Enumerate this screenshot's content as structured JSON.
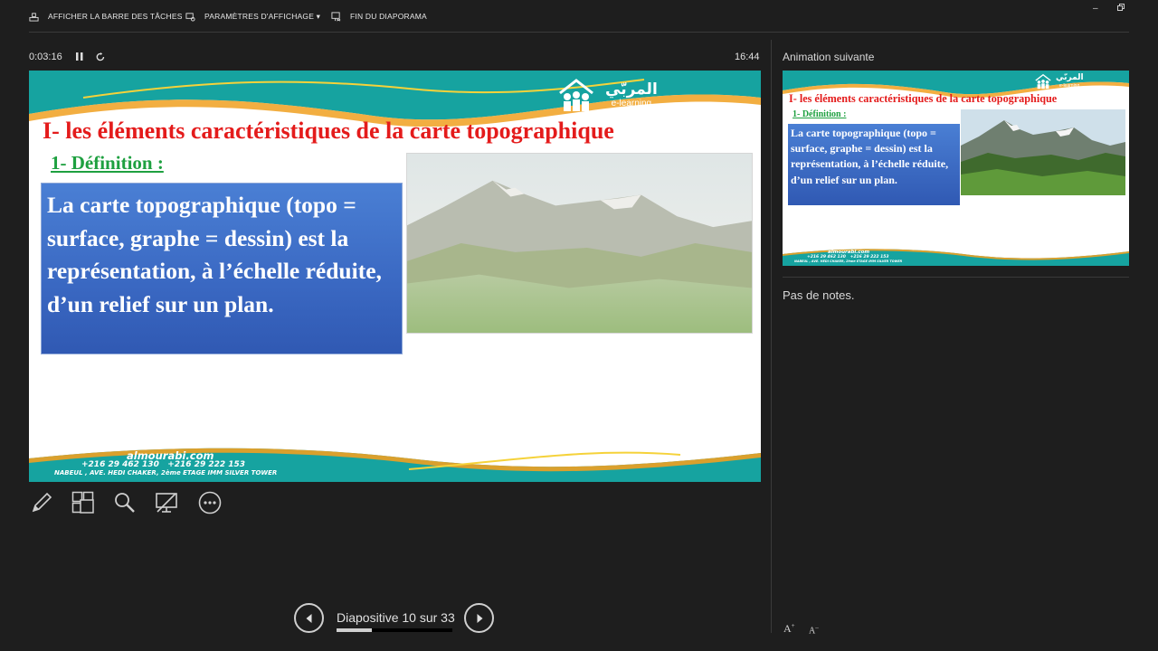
{
  "toolbar": {
    "taskbar_label": "AFFICHER LA BARRE DES TÂCHES",
    "display_settings_label": "PARAMÈTRES D'AFFICHAGE ▾",
    "end_show_label": "FIN DU DIAPORAMA",
    "minimize_icon": "minimize-icon",
    "restore_icon": "restore-icon"
  },
  "presenter": {
    "elapsed_time": "0:03:16",
    "clock": "16:44",
    "slide_counter": "Diapositive 10 sur 33",
    "progress": 0.303
  },
  "slide": {
    "title": "I- les éléments caractéristiques de la carte topographique",
    "subtitle": "1- Définition :",
    "body": "La carte topographique (topo = surface, graphe = dessin) est la représentation, à l’échelle réduite, d’un relief sur un plan.",
    "logo_arabic": "المربّي",
    "logo_elearning": "e-learning",
    "footer_website": "almourabi.com",
    "footer_phones": "+216 29 462 130   +216 29 222 153",
    "footer_address": "NABEUL , AVE. HEDI CHAKER, 2ème ETAGE IMM SILVER TOWER",
    "colors": {
      "title": "#e41b1b",
      "subtitle": "#1ea040",
      "box": "#3a68c2",
      "teal": "#169d9a",
      "orange": "#f0a020"
    }
  },
  "tools": [
    "pen-icon",
    "slides-grid-icon",
    "zoom-icon",
    "black-screen-icon",
    "more-options-icon"
  ],
  "right_panel": {
    "next_animation_label": "Animation suivante",
    "notes": "Pas de notes.",
    "thumb": {
      "title": "I- les éléments caractéristiques de la carte topographique",
      "subtitle": "1- Définition :",
      "body": "La carte topographique (topo = surface, graphe = dessin) est la représentation, à l’échelle réduite, d’un relief sur un plan.",
      "footer_website": "almourabi.com",
      "footer_phones": "+216 29 462 130   +216 29 222 153",
      "footer_address": "NABEUL , AVE. HEDI CHAKER, 2ème ETAGE IMM SILVER TOWER"
    },
    "font_increase_label": "A",
    "font_decrease_label": "A"
  }
}
